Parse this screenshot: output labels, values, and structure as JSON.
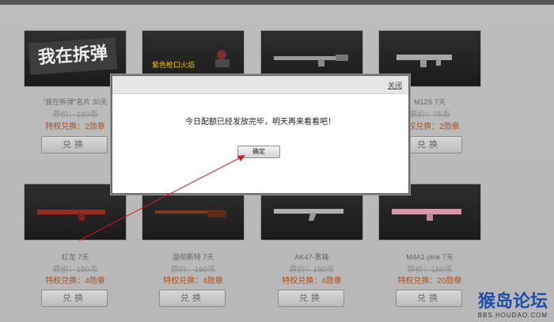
{
  "modal": {
    "close_label": "关闭",
    "message": "今日配额已经发放完毕，明天再来看看吧！",
    "ok_label": "确定"
  },
  "items_row1": [
    {
      "thumb_text": "我在拆弹",
      "name": "“我在拆弹”名片 30天",
      "price": "原价：180币",
      "special": "特权兑换：2勋章",
      "button": "兑换"
    },
    {
      "thumb_text": "紫色枪口火焰",
      "name": "",
      "price": "",
      "special": "",
      "button": ""
    },
    {
      "thumb_text": "",
      "name": "",
      "price": "",
      "special": "",
      "button": ""
    },
    {
      "thumb_text": "",
      "name": "M12S 7天",
      "price": "原价：75币",
      "special": "特权兑换：2勋章",
      "button": "兑换"
    }
  ],
  "items_row2": [
    {
      "name": "红龙 7天",
      "price": "原价：150币",
      "special": "特权兑换：4勋章",
      "button": "兑换"
    },
    {
      "name": "温彻斯特 7天",
      "price": "原价：150币",
      "special": "特权兑换：4勋章",
      "button": "兑换"
    },
    {
      "name": "AK47-黑锋",
      "price": "原价：150币",
      "special": "特权兑换：4勋章",
      "button": "兑换"
    },
    {
      "name": "M4A1-pink 7天",
      "price": "原价：150币",
      "special": "特权兑换：20勋章",
      "button": "兑换"
    }
  ],
  "watermark": {
    "main": "猴岛论坛",
    "url": "BBS.HOUDAO.COM"
  },
  "colors": {
    "accent_text": "#a8501e",
    "arrow": "#d11a1a",
    "watermark": "#1e4ea8"
  }
}
